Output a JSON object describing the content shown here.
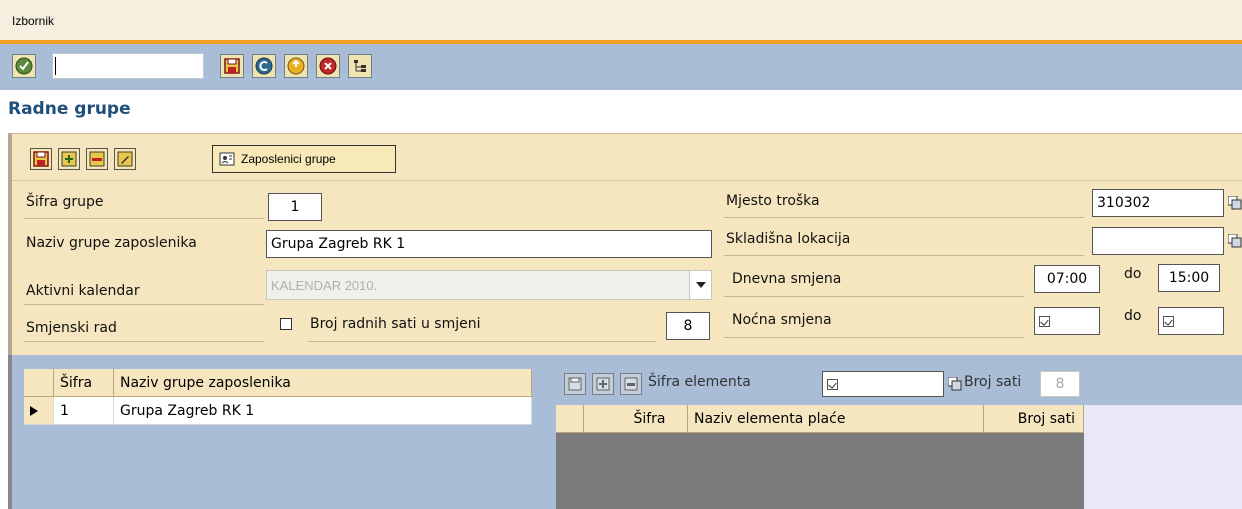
{
  "menu": {
    "label": "Izbornik"
  },
  "toolbar": {
    "command_value": "",
    "icons": [
      "enter-icon",
      "save-icon",
      "back-icon",
      "exit-icon",
      "cancel-icon",
      "tree-icon"
    ]
  },
  "page": {
    "title": "Radne grupe"
  },
  "form_toolbar": {
    "icons": [
      "save-icon",
      "add-icon",
      "delete-icon",
      "edit-icon"
    ],
    "staff_button_label": "Zaposlenici grupe"
  },
  "form": {
    "group_code": {
      "label": "Šifra grupe",
      "value": "1"
    },
    "group_name": {
      "label": "Naziv grupe zaposlenika",
      "value": "Grupa Zagreb RK 1"
    },
    "active_calendar": {
      "label": "Aktivni kalendar",
      "value": "KALENDAR 2010."
    },
    "shift_work": {
      "label": "Smjenski rad",
      "checked": false
    },
    "hours_per_shift": {
      "label": "Broj radnih sati u smjeni",
      "value": "8"
    },
    "cost_center": {
      "label": "Mjesto troška",
      "value": "310302"
    },
    "storage_location": {
      "label": "Skladišna lokacija",
      "value": ""
    },
    "day_shift": {
      "label": "Dnevna smjena",
      "from": "07:00",
      "to_label": "do",
      "to": "15:00"
    },
    "night_shift": {
      "label": "Noćna smjena",
      "to_label": "do"
    }
  },
  "groups_table": {
    "columns": [
      "Šifra",
      "Naziv grupe zaposlenika"
    ],
    "rows": [
      {
        "code": "1",
        "name": "Grupa Zagreb RK 1"
      }
    ]
  },
  "elements_panel": {
    "element_code_label": "Šifra elementa",
    "hours_label": "Broj sati",
    "hours_value": "8",
    "columns": [
      "Šifra",
      "Naziv elementa plaće",
      "Broj sati"
    ]
  }
}
